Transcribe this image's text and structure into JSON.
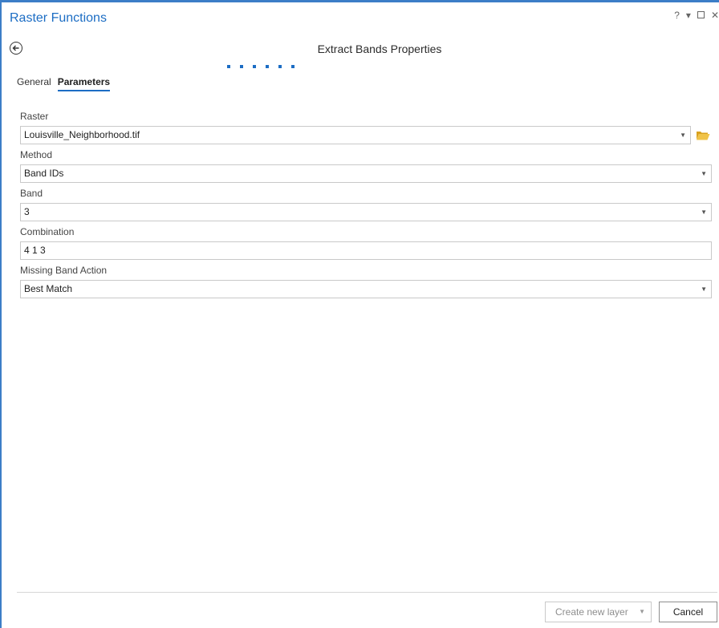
{
  "pane": {
    "title": "Raster Functions",
    "controls": {
      "help": "?",
      "options": "▾"
    }
  },
  "header": {
    "title": "Extract Bands Properties"
  },
  "tabs": [
    {
      "label": "General",
      "active": false
    },
    {
      "label": "Parameters",
      "active": true
    }
  ],
  "fields": {
    "raster": {
      "label": "Raster",
      "value": "Louisville_Neighborhood.tif"
    },
    "method": {
      "label": "Method",
      "value": "Band IDs"
    },
    "band": {
      "label": "Band",
      "value": "3"
    },
    "combination": {
      "label": "Combination",
      "value": "4 1 3"
    },
    "missing_band_action": {
      "label": "Missing Band Action",
      "value": "Best Match"
    }
  },
  "footer": {
    "create_label": "Create new layer",
    "cancel_label": "Cancel"
  },
  "colors": {
    "accent": "#1c6dc4",
    "folder": "#e8b931"
  }
}
